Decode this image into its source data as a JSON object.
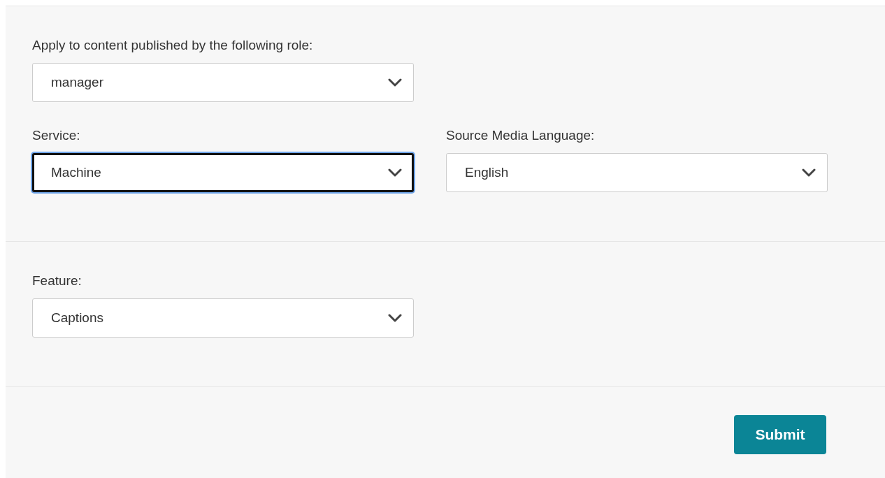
{
  "sections": [
    {
      "rows": [
        [
          {
            "label": "Apply to content published by the following role:",
            "value": "manager",
            "focused": false
          }
        ],
        [
          {
            "label": "Service:",
            "value": "Machine",
            "focused": true
          },
          {
            "label": "Source Media Language:",
            "value": "English",
            "focused": false
          }
        ]
      ]
    },
    {
      "rows": [
        [
          {
            "label": "Feature:",
            "value": "Captions",
            "focused": false
          }
        ]
      ]
    }
  ],
  "submit": {
    "label": "Submit"
  }
}
